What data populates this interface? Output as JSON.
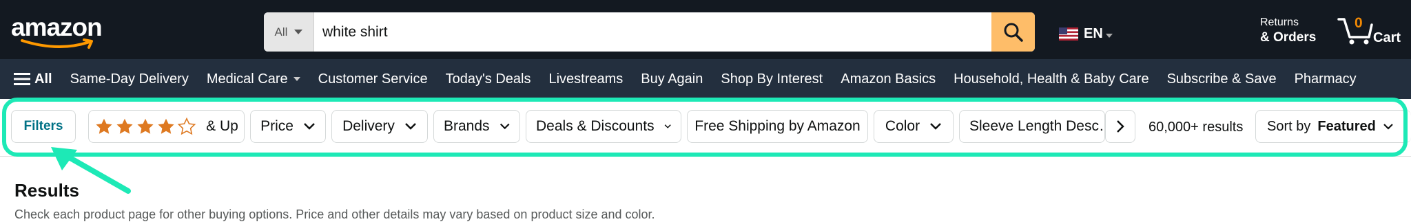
{
  "header": {
    "logo_text": "amazon",
    "search": {
      "category": "All",
      "query": "white shirt"
    },
    "language": "EN",
    "returns_line1": "Returns",
    "returns_line2": "& Orders",
    "cart_count": "0",
    "cart_label": "Cart"
  },
  "subnav": {
    "all_label": "All",
    "items": [
      "Same-Day Delivery",
      "Medical Care",
      "Customer Service",
      "Today's Deals",
      "Livestreams",
      "Buy Again",
      "Shop By Interest",
      "Amazon Basics",
      "Household, Health & Baby Care",
      "Subscribe & Save",
      "Pharmacy"
    ]
  },
  "filters": {
    "filters_label": "Filters",
    "rating_label": "& Up",
    "rating_stars": 4,
    "chips": [
      "Price",
      "Delivery",
      "Brands",
      "Deals & Discounts",
      "Free Shipping by Amazon",
      "Color",
      "Sleeve Length Desc…"
    ],
    "results_count": "60,000+ results",
    "sort_prefix": "Sort by",
    "sort_value": "Featured"
  },
  "results": {
    "title": "Results",
    "subtitle": "Check each product page for other buying options. Price and other details may vary based on product size and color."
  },
  "colors": {
    "nav_dark": "#131921",
    "subnav": "#232f3e",
    "search_button": "#febd69",
    "highlight": "#1de9b6",
    "star": "#de7921",
    "link": "#007185"
  }
}
